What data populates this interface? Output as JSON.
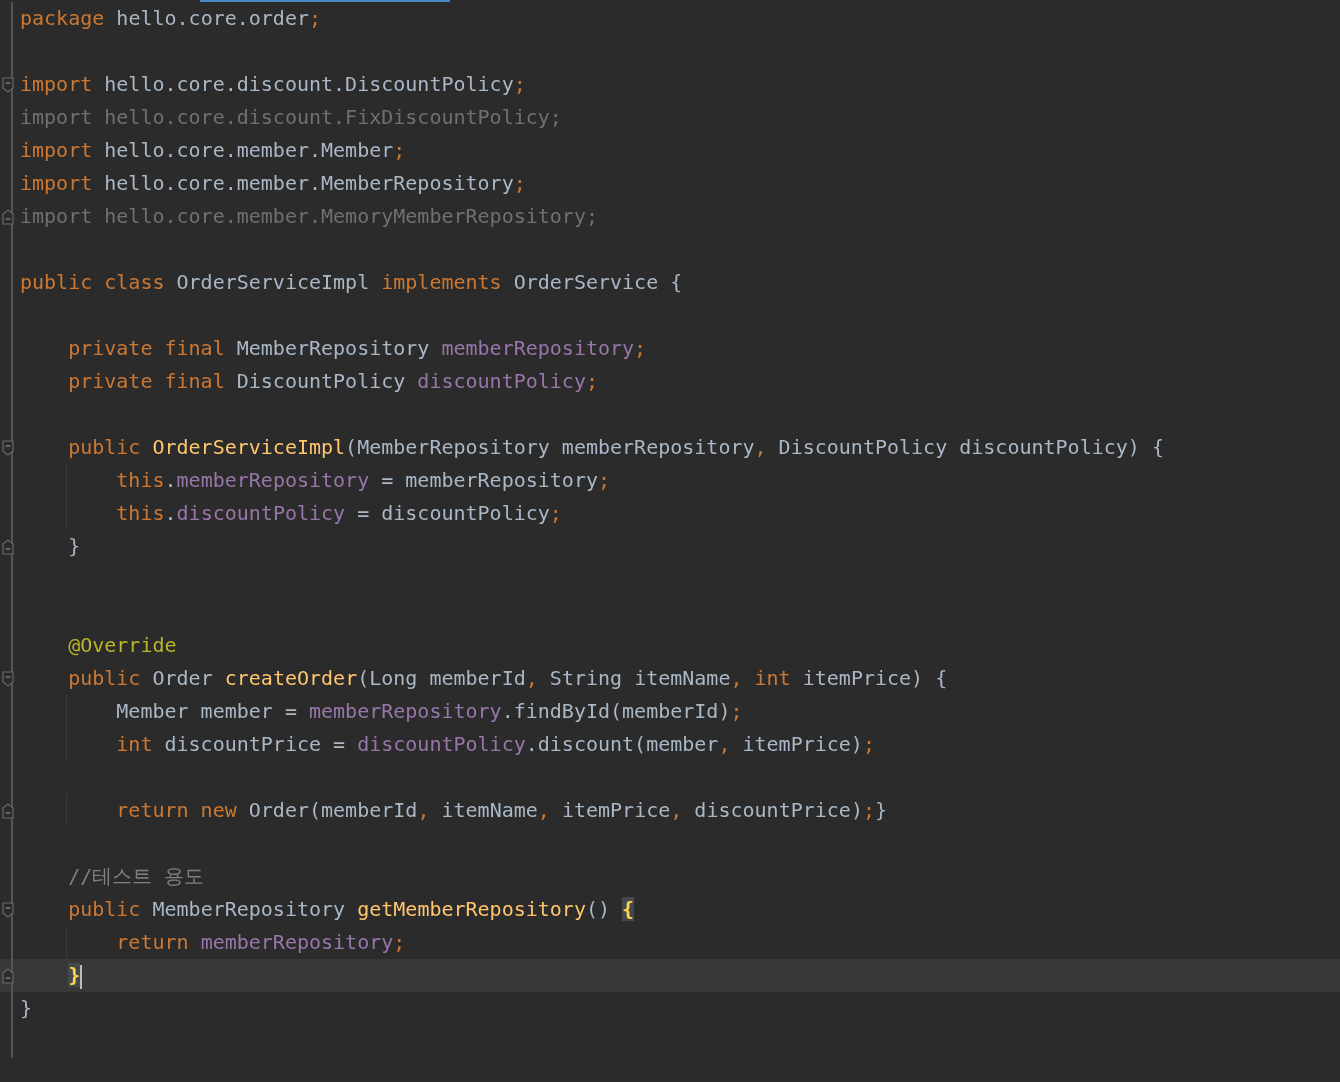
{
  "editor": {
    "lines": [
      {
        "fold_start": false,
        "fold_end": false,
        "current": false,
        "caret": false,
        "tokens": [
          {
            "kind": "keyword",
            "text": "package"
          },
          {
            "kind": "plain",
            "text": " hello.core.order"
          },
          {
            "kind": "keyword",
            "text": ";"
          }
        ]
      },
      {
        "fold_start": false,
        "fold_end": false,
        "current": false,
        "caret": false
      },
      {
        "fold_start": true,
        "fold_end": false,
        "current": false,
        "caret": false,
        "tokens": [
          {
            "kind": "keyword",
            "text": "import"
          },
          {
            "kind": "plain",
            "text": " hello.core.discount.DiscountPolicy"
          },
          {
            "kind": "keyword",
            "text": ";"
          }
        ]
      },
      {
        "fold_start": false,
        "fold_end": false,
        "current": false,
        "caret": false,
        "tokens": [
          {
            "kind": "unused",
            "text": "import hello.core.discount.FixDiscountPolicy;"
          }
        ]
      },
      {
        "fold_start": false,
        "fold_end": false,
        "current": false,
        "caret": false,
        "tokens": [
          {
            "kind": "keyword",
            "text": "import"
          },
          {
            "kind": "plain",
            "text": " hello.core.member.Member"
          },
          {
            "kind": "keyword",
            "text": ";"
          }
        ]
      },
      {
        "fold_start": false,
        "fold_end": false,
        "current": false,
        "caret": false,
        "tokens": [
          {
            "kind": "keyword",
            "text": "import"
          },
          {
            "kind": "plain",
            "text": " hello.core.member.MemberRepository"
          },
          {
            "kind": "keyword",
            "text": ";"
          }
        ]
      },
      {
        "fold_start": false,
        "fold_end": true,
        "current": false,
        "caret": false,
        "tokens": [
          {
            "kind": "unused",
            "text": "import hello.core.member.MemoryMemberRepository;"
          }
        ]
      },
      {
        "fold_start": false,
        "fold_end": false,
        "current": false,
        "caret": false
      },
      {
        "fold_start": false,
        "fold_end": false,
        "current": false,
        "caret": false,
        "tokens": [
          {
            "kind": "keyword",
            "text": "public class"
          },
          {
            "kind": "plain",
            "text": " OrderServiceImpl "
          },
          {
            "kind": "keyword",
            "text": "implements"
          },
          {
            "kind": "plain",
            "text": " OrderService {"
          }
        ]
      },
      {
        "fold_start": false,
        "fold_end": false,
        "current": false,
        "caret": false
      },
      {
        "fold_start": false,
        "fold_end": false,
        "current": false,
        "caret": false,
        "tokens": [
          {
            "kind": "keyword",
            "text": "    private final"
          },
          {
            "kind": "plain",
            "text": " MemberRepository "
          },
          {
            "kind": "field",
            "text": "memberRepository"
          },
          {
            "kind": "keyword",
            "text": ";"
          }
        ]
      },
      {
        "fold_start": false,
        "fold_end": false,
        "current": false,
        "caret": false,
        "tokens": [
          {
            "kind": "keyword",
            "text": "    private final"
          },
          {
            "kind": "plain",
            "text": " DiscountPolicy "
          },
          {
            "kind": "field",
            "text": "discountPolicy"
          },
          {
            "kind": "keyword",
            "text": ";"
          }
        ]
      },
      {
        "fold_start": false,
        "fold_end": false,
        "current": false,
        "caret": false
      },
      {
        "fold_start": true,
        "fold_end": false,
        "current": false,
        "caret": false,
        "tokens": [
          {
            "kind": "keyword",
            "text": "    public "
          },
          {
            "kind": "method",
            "text": "OrderServiceImpl"
          },
          {
            "kind": "plain",
            "text": "(MemberRepository memberRepository"
          },
          {
            "kind": "keyword",
            "text": ","
          },
          {
            "kind": "plain",
            "text": " DiscountPolicy discountPolicy) {"
          }
        ]
      },
      {
        "fold_start": false,
        "fold_end": false,
        "current": false,
        "caret": false,
        "tokens": [
          {
            "kind": "keyword",
            "text": "        this"
          },
          {
            "kind": "plain",
            "text": "."
          },
          {
            "kind": "field",
            "text": "memberRepository"
          },
          {
            "kind": "plain",
            "text": " = memberRepository"
          },
          {
            "kind": "keyword",
            "text": ";"
          }
        ]
      },
      {
        "fold_start": false,
        "fold_end": false,
        "current": false,
        "caret": false,
        "tokens": [
          {
            "kind": "keyword",
            "text": "        this"
          },
          {
            "kind": "plain",
            "text": "."
          },
          {
            "kind": "field",
            "text": "discountPolicy"
          },
          {
            "kind": "plain",
            "text": " = discountPolicy"
          },
          {
            "kind": "keyword",
            "text": ";"
          }
        ]
      },
      {
        "fold_start": false,
        "fold_end": true,
        "current": false,
        "caret": false,
        "tokens": [
          {
            "kind": "plain",
            "text": "    }"
          }
        ]
      },
      {
        "fold_start": false,
        "fold_end": false,
        "current": false,
        "caret": false
      },
      {
        "fold_start": false,
        "fold_end": false,
        "current": false,
        "caret": false
      },
      {
        "fold_start": false,
        "fold_end": false,
        "current": false,
        "caret": false,
        "tokens": [
          {
            "kind": "annotation",
            "text": "    @Override"
          }
        ]
      },
      {
        "fold_start": true,
        "fold_end": false,
        "current": false,
        "caret": false,
        "tokens": [
          {
            "kind": "keyword",
            "text": "    public"
          },
          {
            "kind": "plain",
            "text": " Order "
          },
          {
            "kind": "method",
            "text": "createOrder"
          },
          {
            "kind": "plain",
            "text": "(Long memberId"
          },
          {
            "kind": "keyword",
            "text": ","
          },
          {
            "kind": "plain",
            "text": " String itemName"
          },
          {
            "kind": "keyword",
            "text": ","
          },
          {
            "kind": "keyword",
            "text": " int"
          },
          {
            "kind": "plain",
            "text": " itemPrice) {"
          }
        ]
      },
      {
        "fold_start": false,
        "fold_end": false,
        "current": false,
        "caret": false,
        "tokens": [
          {
            "kind": "plain",
            "text": "        Member member = "
          },
          {
            "kind": "field",
            "text": "memberRepository"
          },
          {
            "kind": "plain",
            "text": ".findById(memberId)"
          },
          {
            "kind": "keyword",
            "text": ";"
          }
        ]
      },
      {
        "fold_start": false,
        "fold_end": false,
        "current": false,
        "caret": false,
        "tokens": [
          {
            "kind": "keyword",
            "text": "        int"
          },
          {
            "kind": "plain",
            "text": " discountPrice = "
          },
          {
            "kind": "field",
            "text": "discountPolicy"
          },
          {
            "kind": "plain",
            "text": ".discount(member"
          },
          {
            "kind": "keyword",
            "text": ","
          },
          {
            "kind": "plain",
            "text": " itemPrice)"
          },
          {
            "kind": "keyword",
            "text": ";"
          }
        ]
      },
      {
        "fold_start": false,
        "fold_end": false,
        "current": false,
        "caret": false
      },
      {
        "fold_start": false,
        "fold_end": true,
        "current": false,
        "caret": false,
        "tokens": [
          {
            "kind": "keyword",
            "text": "        return new"
          },
          {
            "kind": "plain",
            "text": " Order(memberId"
          },
          {
            "kind": "keyword",
            "text": ","
          },
          {
            "kind": "plain",
            "text": " itemName"
          },
          {
            "kind": "keyword",
            "text": ","
          },
          {
            "kind": "plain",
            "text": " itemPrice"
          },
          {
            "kind": "keyword",
            "text": ","
          },
          {
            "kind": "plain",
            "text": " discountPrice)"
          },
          {
            "kind": "keyword",
            "text": ";"
          },
          {
            "kind": "plain",
            "text": "}"
          }
        ]
      },
      {
        "fold_start": false,
        "fold_end": false,
        "current": false,
        "caret": false
      },
      {
        "fold_start": false,
        "fold_end": false,
        "current": false,
        "caret": false,
        "tokens": [
          {
            "kind": "comment",
            "text": "    //테스트 용도"
          }
        ]
      },
      {
        "fold_start": true,
        "fold_end": false,
        "current": false,
        "caret": false,
        "tokens": [
          {
            "kind": "keyword",
            "text": "    public"
          },
          {
            "kind": "plain",
            "text": " MemberRepository "
          },
          {
            "kind": "method",
            "text": "getMemberRepository"
          },
          {
            "kind": "plain",
            "text": "() "
          },
          {
            "kind": "brace",
            "text": "{"
          }
        ]
      },
      {
        "fold_start": false,
        "fold_end": false,
        "current": false,
        "caret": false,
        "tokens": [
          {
            "kind": "keyword",
            "text": "        return "
          },
          {
            "kind": "field",
            "text": "memberRepository"
          },
          {
            "kind": "keyword",
            "text": ";"
          }
        ]
      },
      {
        "fold_start": false,
        "fold_end": true,
        "current": true,
        "caret": true,
        "tokens": [
          {
            "kind": "brace",
            "text": "    }"
          }
        ]
      },
      {
        "fold_start": false,
        "fold_end": false,
        "current": false,
        "caret": false,
        "tokens": [
          {
            "kind": "plain",
            "text": "}"
          }
        ]
      },
      {
        "fold_start": false,
        "fold_end": false,
        "current": false,
        "caret": false
      }
    ]
  }
}
